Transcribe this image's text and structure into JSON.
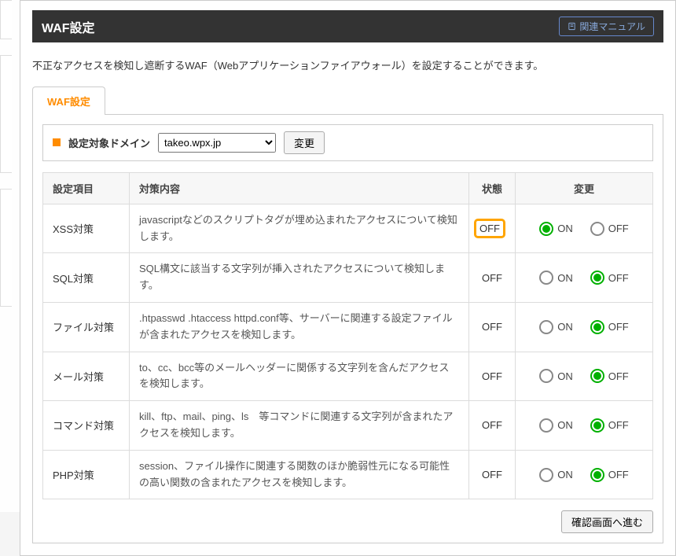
{
  "header": {
    "title": "WAF設定",
    "manual_link": "関連マニュアル"
  },
  "description": "不正なアクセスを検知し遮断するWAF（Webアプリケーションファイアウォール）を設定することができます。",
  "tab_label": "WAF設定",
  "domain_bar": {
    "label": "設定対象ドメイン",
    "selected": "takeo.wpx.jp",
    "change_button": "変更"
  },
  "table": {
    "headers": {
      "item": "設定項目",
      "content": "対策内容",
      "status": "状態",
      "change": "変更"
    },
    "on_label": "ON",
    "off_label": "OFF",
    "rows": [
      {
        "item": "XSS対策",
        "content": "javascriptなどのスクリプトタグが埋め込まれたアクセスについて検知します。",
        "status": "OFF",
        "value": "ON",
        "highlight_status": true
      },
      {
        "item": "SQL対策",
        "content": "SQL構文に該当する文字列が挿入されたアクセスについて検知します。",
        "status": "OFF",
        "value": "OFF",
        "highlight_status": false
      },
      {
        "item": "ファイル対策",
        "content": ".htpasswd .htaccess httpd.conf等、サーバーに関連する設定ファイルが含まれたアクセスを検知します。",
        "status": "OFF",
        "value": "OFF",
        "highlight_status": false
      },
      {
        "item": "メール対策",
        "content": "to、cc、bcc等のメールヘッダーに関係する文字列を含んだアクセスを検知します。",
        "status": "OFF",
        "value": "OFF",
        "highlight_status": false
      },
      {
        "item": "コマンド対策",
        "content": "kill、ftp、mail、ping、ls　等コマンドに関連する文字列が含まれたアクセスを検知します。",
        "status": "OFF",
        "value": "OFF",
        "highlight_status": false
      },
      {
        "item": "PHP対策",
        "content": "session、ファイル操作に関連する関数のほか脆弱性元になる可能性の高い関数の含まれたアクセスを検知します。",
        "status": "OFF",
        "value": "OFF",
        "highlight_status": false
      }
    ]
  },
  "confirm_button": "確認画面へ進む"
}
